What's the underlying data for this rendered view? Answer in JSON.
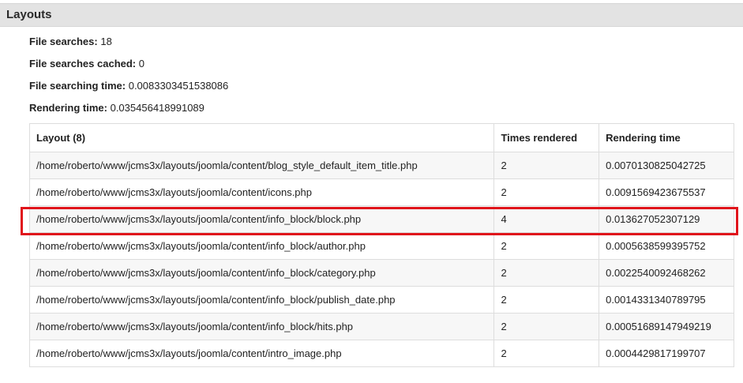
{
  "section": {
    "title": "Layouts"
  },
  "stats": [
    {
      "label": "File searches:",
      "value": "18"
    },
    {
      "label": "File searches cached:",
      "value": "0"
    },
    {
      "label": "File searching time:",
      "value": "0.0083303451538086"
    },
    {
      "label": "Rendering time:",
      "value": "0.035456418991089"
    }
  ],
  "table": {
    "headers": [
      "Layout (8)",
      "Times rendered",
      "Rendering time"
    ],
    "rows": [
      [
        "/home/roberto/www/jcms3x/layouts/joomla/content/blog_style_default_item_title.php",
        "2",
        "0.0070130825042725"
      ],
      [
        "/home/roberto/www/jcms3x/layouts/joomla/content/icons.php",
        "2",
        "0.0091569423675537"
      ],
      [
        "/home/roberto/www/jcms3x/layouts/joomla/content/info_block/block.php",
        "4",
        "0.013627052307129"
      ],
      [
        "/home/roberto/www/jcms3x/layouts/joomla/content/info_block/author.php",
        "2",
        "0.0005638599395752"
      ],
      [
        "/home/roberto/www/jcms3x/layouts/joomla/content/info_block/category.php",
        "2",
        "0.0022540092468262"
      ],
      [
        "/home/roberto/www/jcms3x/layouts/joomla/content/info_block/publish_date.php",
        "2",
        "0.0014331340789795"
      ],
      [
        "/home/roberto/www/jcms3x/layouts/joomla/content/info_block/hits.php",
        "2",
        "0.00051689147949219"
      ],
      [
        "/home/roberto/www/jcms3x/layouts/joomla/content/intro_image.php",
        "2",
        "0.0004429817199707"
      ]
    ]
  },
  "highlight": {
    "row_index": 2,
    "color": "#e0141b"
  }
}
